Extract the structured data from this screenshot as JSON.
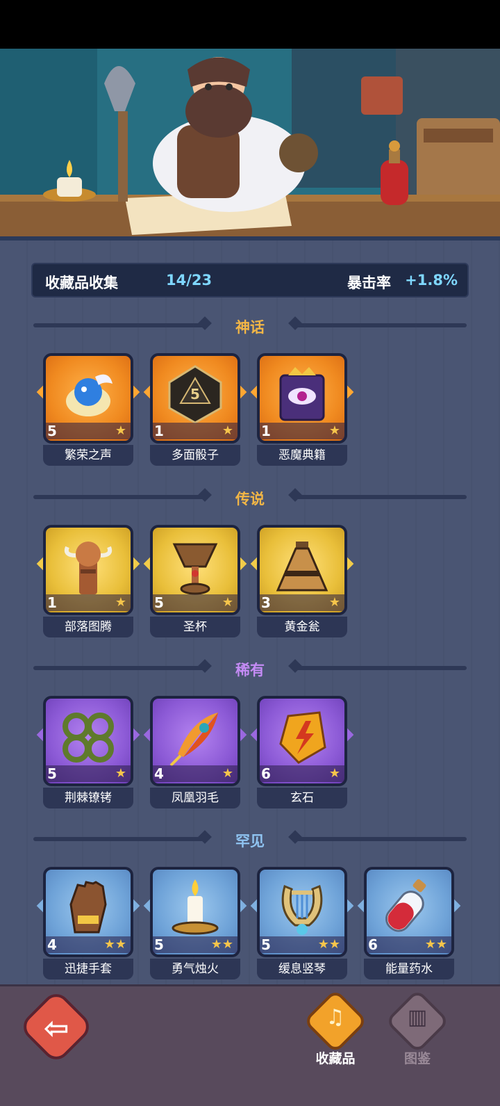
{
  "summary": {
    "label": "收藏品收集",
    "count": "14/23",
    "crit_label": "暴击率",
    "crit_value": "+1.8%"
  },
  "sections": [
    {
      "title": "神话",
      "color": "#f2b646",
      "items": [
        {
          "name": "繁荣之声",
          "count": "5",
          "stars": "★",
          "icon": "blue-spirit-shell-icon"
        },
        {
          "name": "多面骰子",
          "count": "1",
          "stars": "★",
          "icon": "polyhedral-dice-icon"
        },
        {
          "name": "恶魔典籍",
          "count": "1",
          "stars": "★",
          "icon": "demon-eye-tome-icon"
        }
      ]
    },
    {
      "title": "传说",
      "color": "#f2b646",
      "items": [
        {
          "name": "部落图腾",
          "count": "1",
          "stars": "★",
          "icon": "tribal-totem-icon"
        },
        {
          "name": "圣杯",
          "count": "5",
          "stars": "★",
          "icon": "chalice-icon"
        },
        {
          "name": "黄金瓮",
          "count": "3",
          "stars": "★",
          "icon": "golden-urn-icon"
        }
      ]
    },
    {
      "title": "稀有",
      "color": "#c48bf4",
      "items": [
        {
          "name": "荆棘镣铐",
          "count": "5",
          "stars": "★",
          "icon": "thorn-shackles-icon"
        },
        {
          "name": "凤凰羽毛",
          "count": "4",
          "stars": "★",
          "icon": "phoenix-feather-icon"
        },
        {
          "name": "玄石",
          "count": "6",
          "stars": "★",
          "icon": "lightning-stone-icon"
        }
      ]
    },
    {
      "title": "罕见",
      "color": "#8fc3f0",
      "items": [
        {
          "name": "迅捷手套",
          "count": "4",
          "stars": "★★",
          "icon": "leather-glove-icon"
        },
        {
          "name": "勇气烛火",
          "count": "5",
          "stars": "★★",
          "icon": "candle-icon"
        },
        {
          "name": "缓息竖琴",
          "count": "5",
          "stars": "★★",
          "icon": "lyre-icon"
        },
        {
          "name": "能量药水",
          "count": "6",
          "stars": "★★",
          "icon": "potion-icon"
        }
      ]
    }
  ],
  "nav": {
    "collection_label": "收藏品",
    "codex_label": "图鉴"
  }
}
